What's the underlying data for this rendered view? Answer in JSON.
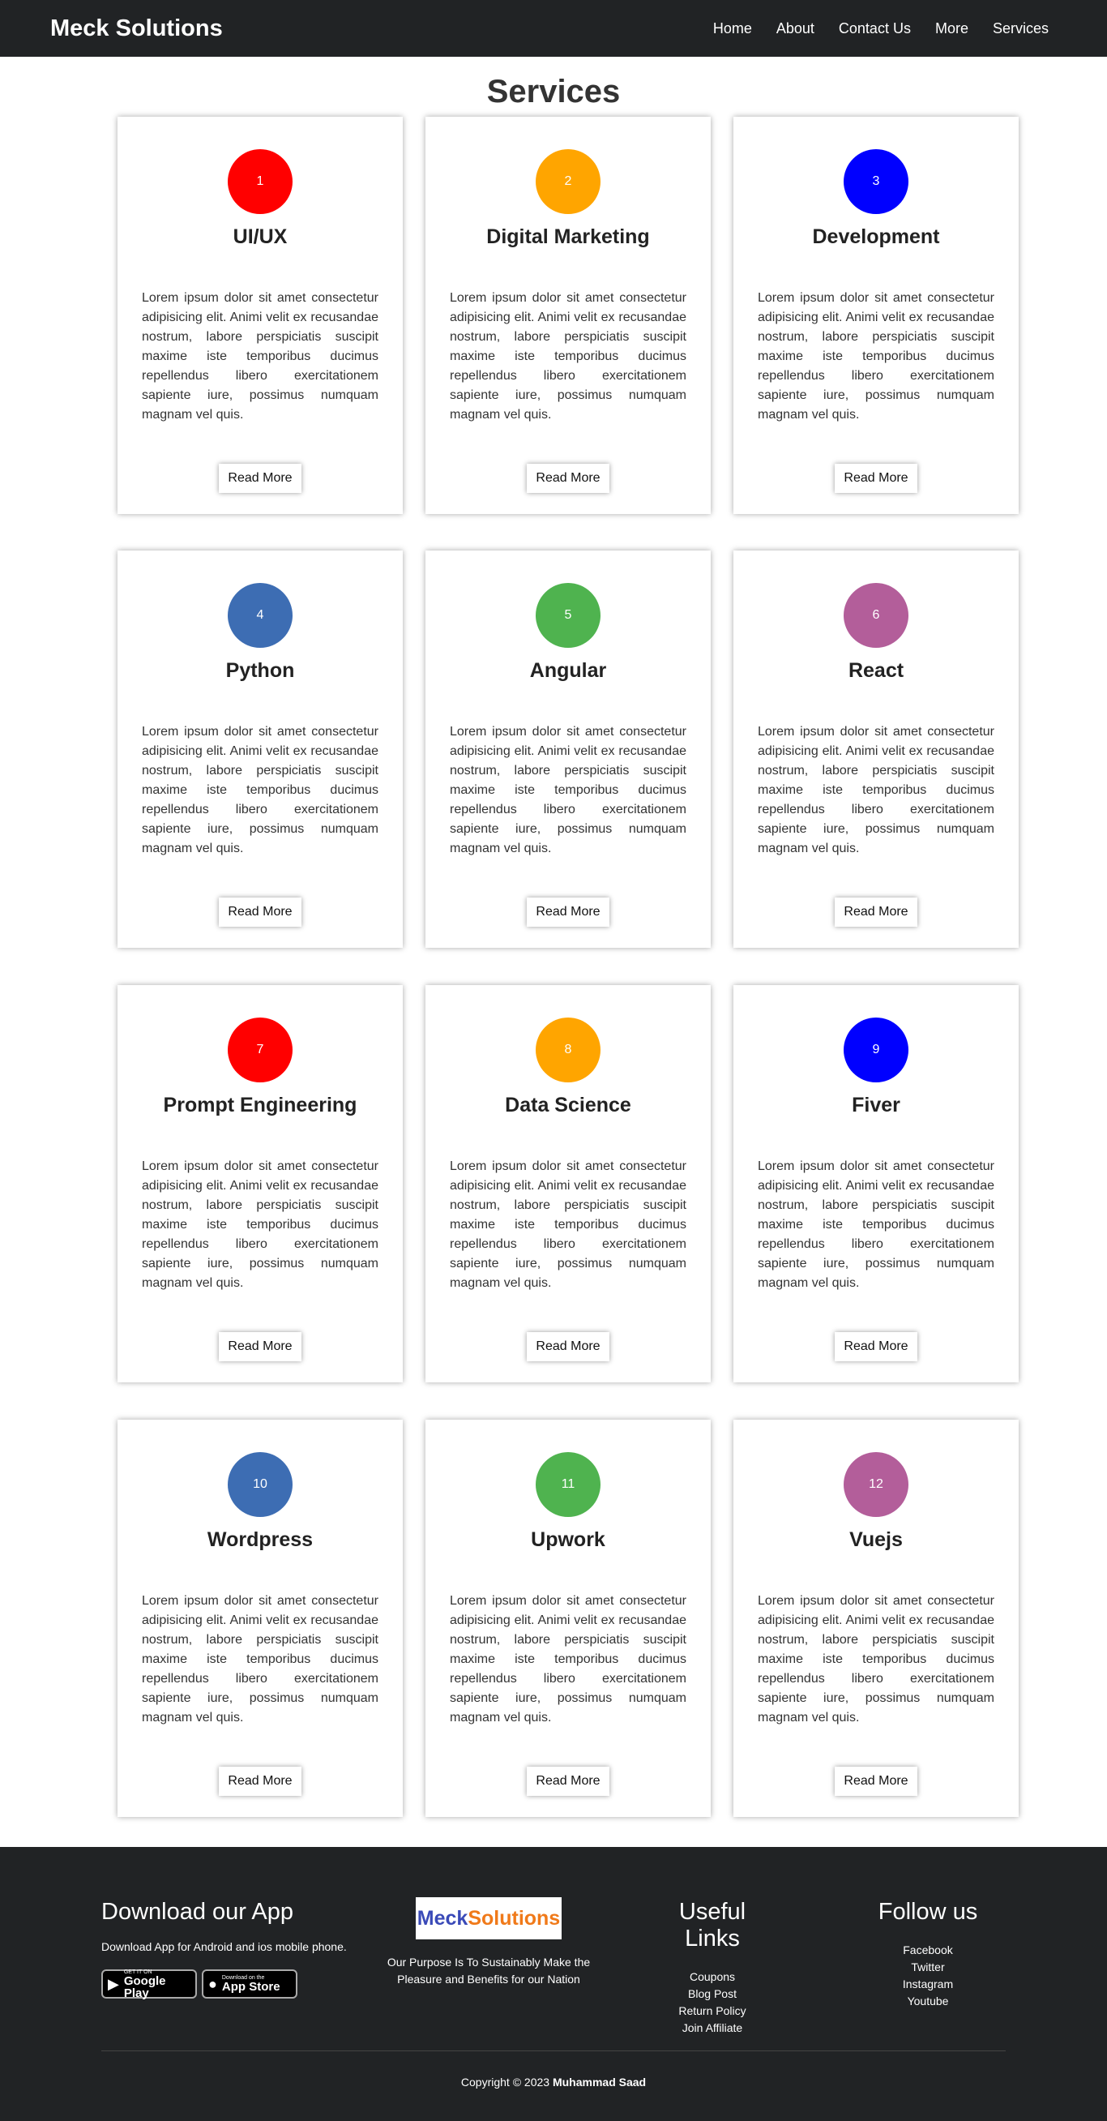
{
  "navbar": {
    "brand": "Meck Solutions",
    "links": [
      "Home",
      "About",
      "Contact Us",
      "More",
      "Services"
    ]
  },
  "page_title": "Services",
  "read_more_label": "Read More",
  "lorem": "Lorem ipsum dolor sit amet consectetur adipisicing elit. Animi velit ex recusandae nostrum, labore perspiciatis suscipit maxime iste temporibus ducimus repellendus libero exercitationem sapiente iure, possimus numquam magnam vel quis.",
  "services": [
    {
      "number": "1",
      "title": "UI/UX",
      "color": "#ff0000"
    },
    {
      "number": "2",
      "title": "Digital Marketing",
      "color": "#ffa500"
    },
    {
      "number": "3",
      "title": "Development",
      "color": "#0000ff"
    },
    {
      "number": "4",
      "title": "Python",
      "color": "#3d6db3"
    },
    {
      "number": "5",
      "title": "Angular",
      "color": "#4fb34f"
    },
    {
      "number": "6",
      "title": "React",
      "color": "#b35e9a"
    },
    {
      "number": "7",
      "title": "Prompt Engineering",
      "color": "#ff0000"
    },
    {
      "number": "8",
      "title": "Data Science",
      "color": "#ffa500"
    },
    {
      "number": "9",
      "title": "Fiver",
      "color": "#0000ff"
    },
    {
      "number": "10",
      "title": "Wordpress",
      "color": "#3d6db3"
    },
    {
      "number": "11",
      "title": "Upwork",
      "color": "#4fb34f"
    },
    {
      "number": "12",
      "title": "Vuejs",
      "color": "#b35e9a"
    }
  ],
  "footer": {
    "app": {
      "heading": "Download our App",
      "text": "Download App for Android and ios mobile phone.",
      "google_play": {
        "top": "GET IT ON",
        "main": "Google Play",
        "icon": "play-icon"
      },
      "app_store": {
        "top": "Download on the",
        "main": "App Store",
        "icon": "apple-icon"
      }
    },
    "logo": {
      "part1": "Meck",
      "part2": "Solutions"
    },
    "tagline": "Our Purpose Is To Sustainably Make the Pleasure and Benefits for our Nation",
    "useful_links": {
      "heading": "Useful Links",
      "items": [
        "Coupons",
        "Blog Post",
        "Return Policy",
        "Join Affiliate"
      ]
    },
    "follow": {
      "heading": "Follow us",
      "items": [
        "Facebook",
        "Twitter",
        "Instagram",
        "Youtube"
      ]
    },
    "copyright_prefix": "Copyright © 2023",
    "copyright_name": "Muhammad Saad"
  }
}
